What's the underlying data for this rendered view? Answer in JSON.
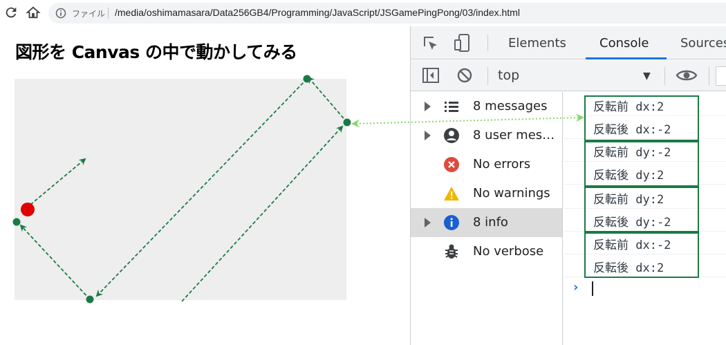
{
  "browser": {
    "file_label": "ファイル",
    "url": "/media/oshimamasara/Data256GB4/Programming/JavaScript/JSGamePingPong/03/index.html"
  },
  "page": {
    "title": "図形を Canvas の中で動かしてみる"
  },
  "devtools": {
    "tabs": [
      "Elements",
      "Console",
      "Sources"
    ],
    "active_tab": "Console",
    "context": "top",
    "sidebar": [
      {
        "label": "8 messages",
        "icon": "list-icon",
        "expandable": true,
        "selected": false
      },
      {
        "label": "8 user mes…",
        "icon": "user-icon",
        "expandable": true,
        "selected": false
      },
      {
        "label": "No errors",
        "icon": "error-icon",
        "expandable": false,
        "selected": false
      },
      {
        "label": "No warnings",
        "icon": "warning-icon",
        "expandable": false,
        "selected": false
      },
      {
        "label": "8 info",
        "icon": "info-icon",
        "expandable": true,
        "selected": true
      },
      {
        "label": "No verbose",
        "icon": "bug-icon",
        "expandable": false,
        "selected": false
      }
    ],
    "logs": [
      "反転前 dx:2",
      "反転後 dx:-2",
      "反転前 dy:-2",
      "反転後 dy:2",
      "反転前 dy:2",
      "反転後 dy:-2",
      "反転前 dx:-2",
      "反転後 dx:2"
    ]
  },
  "colors": {
    "path": "#1a7a45",
    "ball": "#e00000",
    "link_arrow": "#86d86a",
    "accent": "#1a73e8"
  }
}
